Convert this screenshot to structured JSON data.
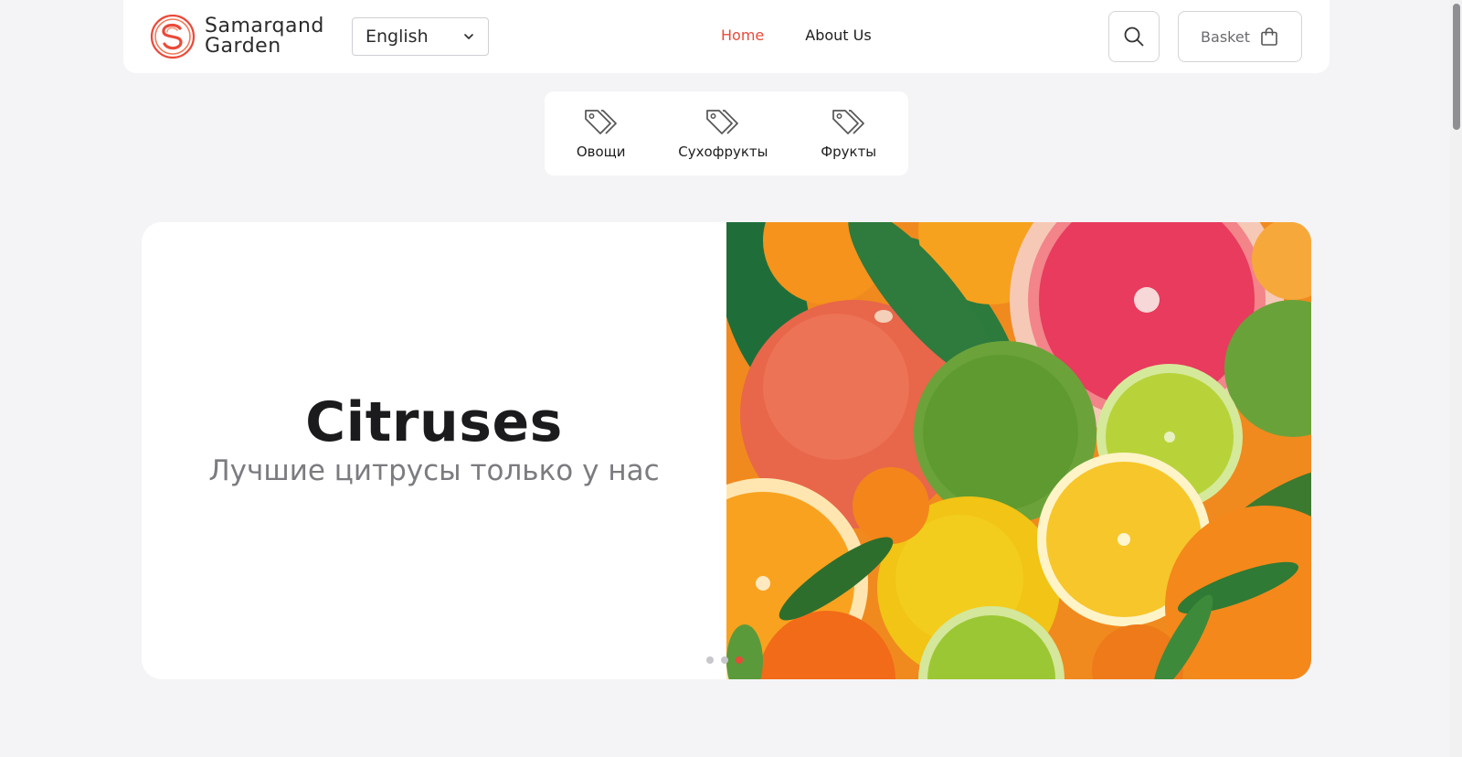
{
  "header": {
    "logo": {
      "line1": "Samarqand",
      "line2": "Garden"
    },
    "language": {
      "selected": "English"
    },
    "nav": [
      {
        "label": "Home",
        "active": true
      },
      {
        "label": "About Us",
        "active": false
      }
    ],
    "basket_label": "Basket"
  },
  "categories": [
    {
      "label": "Овощи",
      "icon": "tag-icon"
    },
    {
      "label": "Сухофрукты",
      "icon": "tag-icon"
    },
    {
      "label": "Фрукты",
      "icon": "tag-icon"
    }
  ],
  "hero": {
    "title": "Citruses",
    "subtitle": "Лучшие цитрусы только у нас",
    "slides_total": 3,
    "active_slide": 3
  },
  "colors": {
    "accent": "#ea4a3a",
    "background": "#f4f4f6",
    "card": "#ffffff"
  }
}
